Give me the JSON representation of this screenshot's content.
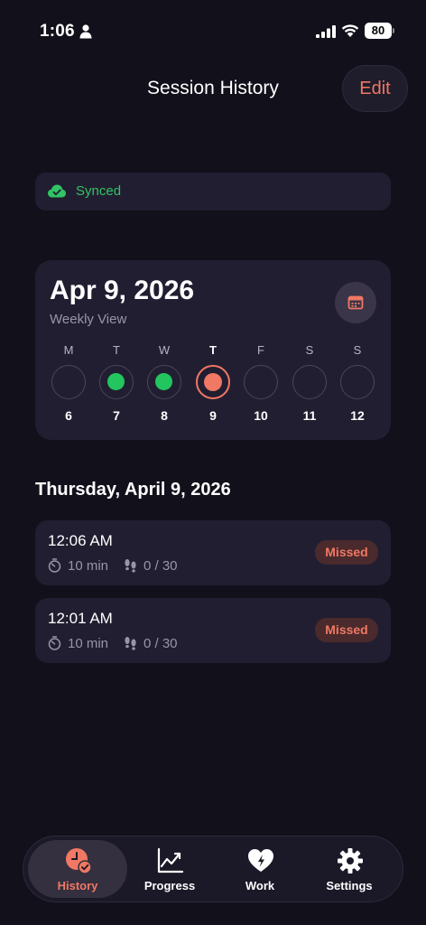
{
  "status_bar": {
    "time": "1:06",
    "battery": "80"
  },
  "header": {
    "title": "Session History",
    "edit_label": "Edit"
  },
  "sync": {
    "label": "Synced",
    "color": "#2fc464"
  },
  "week": {
    "date": "Apr 9, 2026",
    "subtitle": "Weekly View",
    "days": [
      {
        "letter": "M",
        "number": "6",
        "state": "empty"
      },
      {
        "letter": "T",
        "number": "7",
        "state": "completed"
      },
      {
        "letter": "W",
        "number": "8",
        "state": "completed"
      },
      {
        "letter": "T",
        "number": "9",
        "state": "today"
      },
      {
        "letter": "F",
        "number": "10",
        "state": "empty"
      },
      {
        "letter": "S",
        "number": "11",
        "state": "empty"
      },
      {
        "letter": "S",
        "number": "12",
        "state": "empty"
      }
    ]
  },
  "sessions": {
    "heading": "Thursday, April 9, 2026",
    "items": [
      {
        "time": "12:06 AM",
        "duration": "10 min",
        "steps": "0 / 30",
        "status": "Missed"
      },
      {
        "time": "12:01 AM",
        "duration": "10 min",
        "steps": "0 / 30",
        "status": "Missed"
      }
    ]
  },
  "tabs": [
    {
      "label": "History",
      "icon": "history-icon",
      "active": true
    },
    {
      "label": "Progress",
      "icon": "chart-icon",
      "active": false
    },
    {
      "label": "Work",
      "icon": "heart-bolt-icon",
      "active": false
    },
    {
      "label": "Settings",
      "icon": "gear-icon",
      "active": false
    }
  ],
  "colors": {
    "accent": "#f07864",
    "success": "#22c55e",
    "background": "#12101b",
    "card": "#221e31"
  }
}
